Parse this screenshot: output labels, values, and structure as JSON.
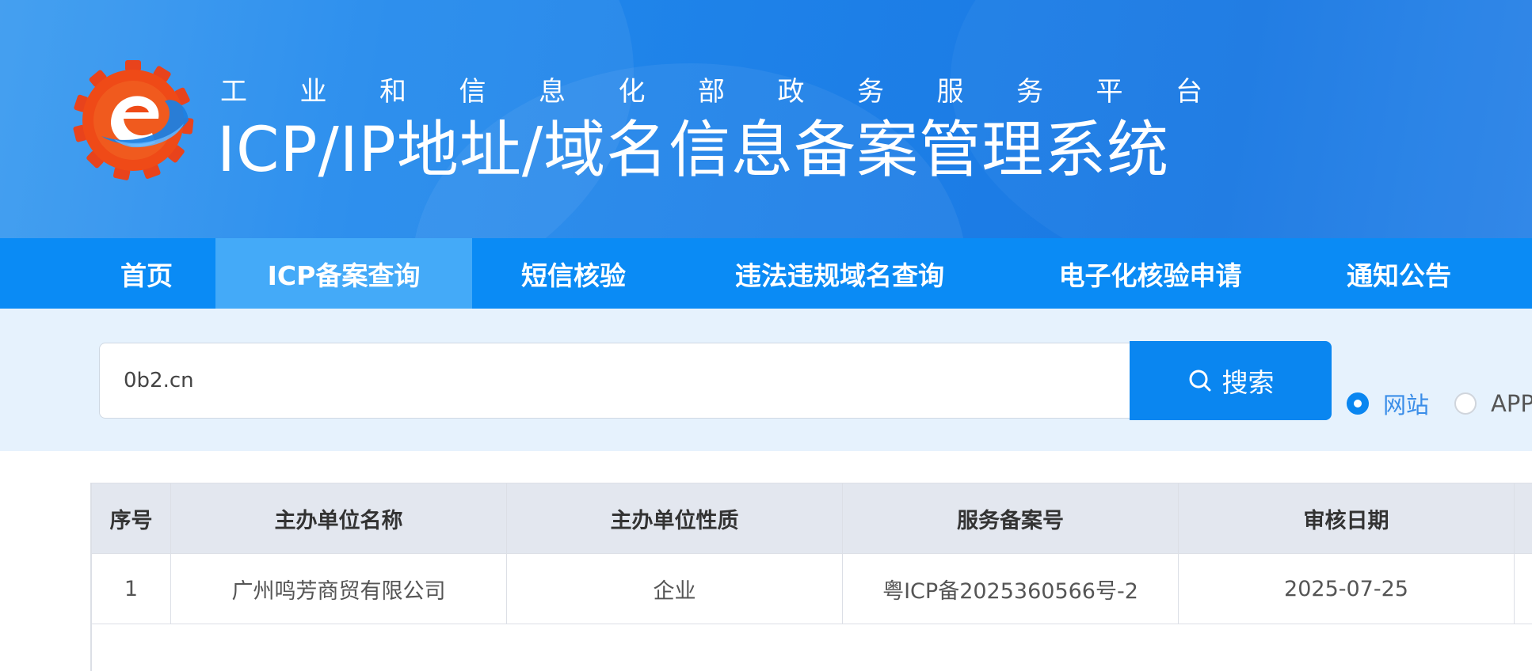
{
  "header": {
    "subtitle_chars": [
      "工",
      "业",
      "和",
      "信",
      "息",
      "化",
      "部",
      "政",
      "务",
      "服",
      "务",
      "平",
      "台"
    ],
    "title": "ICP/IP地址/域名信息备案管理系统"
  },
  "nav": {
    "items": [
      {
        "label": "首页",
        "active": false
      },
      {
        "label": "ICP备案查询",
        "active": true
      },
      {
        "label": "短信核验",
        "active": false
      },
      {
        "label": "违法违规域名查询",
        "active": false
      },
      {
        "label": "电子化核验申请",
        "active": false
      },
      {
        "label": "通知公告",
        "active": false
      }
    ]
  },
  "search": {
    "value": "0b2.cn",
    "button_label": "搜索",
    "options": [
      {
        "label": "网站",
        "checked": true
      },
      {
        "label": "APP",
        "checked": false
      }
    ]
  },
  "table": {
    "columns": [
      "序号",
      "主办单位名称",
      "主办单位性质",
      "服务备案号",
      "审核日期",
      ""
    ],
    "rows": [
      [
        "1",
        "广州鸣芳商贸有限公司",
        "企业",
        "粤ICP备2025360566号-2",
        "2025-07-25",
        ""
      ]
    ]
  },
  "colors": {
    "banner": "#1d7fe7",
    "nav": "#0a8bf5",
    "nav_active": "#44aaf8",
    "search_band": "#e6f2fd",
    "accent": "#0a86f0"
  },
  "icons": {
    "logo": "gear-e-logo",
    "search": "search-icon"
  }
}
